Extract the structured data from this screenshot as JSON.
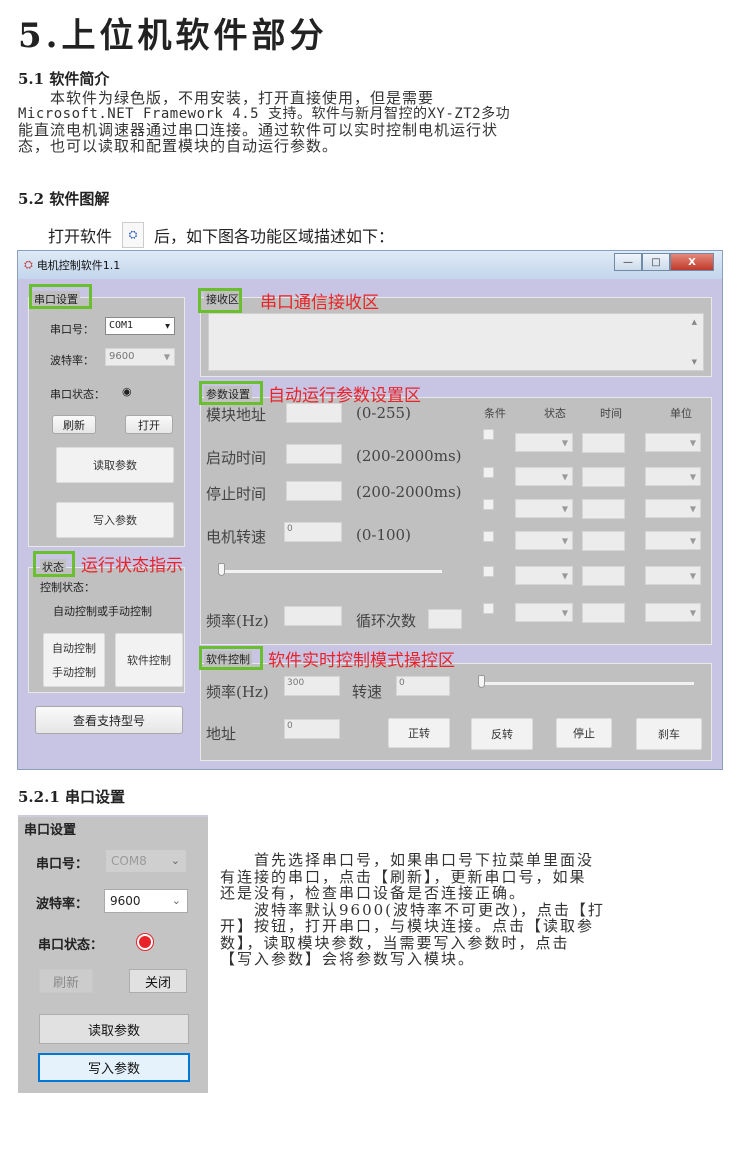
{
  "heading": "5.上位机软件部分",
  "section_5_1": {
    "title": "5.1 软件简介",
    "lines": [
      "　　本软件为绿色版，不用安装，打开直接使用，但是需要",
      "Microsoft.NET Framework 4.5 支持。软件与新月智控的XY-ZT2多功",
      "能直流电机调速器通过串口连接。通过软件可以实时控制电机运行状",
      "态，也可以读取和配置模块的自动运行参数。"
    ]
  },
  "section_5_2": {
    "title": "5.2 软件图解",
    "open_prefix": "打开软件",
    "open_suffix": "后，如下图各功能区域描述如下："
  },
  "window": {
    "title": "电机控制软件1.1",
    "buttons": {
      "minimize": "—",
      "maximize": "□",
      "close": "X"
    },
    "serial_group": {
      "label": "串口设置",
      "port_label": "串口号：",
      "port_value": "COM1",
      "baud_label": "波特率：",
      "baud_value": "9600",
      "status_label": "串口状态：",
      "status_indicator": "◉",
      "refresh": "刷新",
      "open": "打开",
      "read_params": "读取参数",
      "write_params": "写入参数"
    },
    "status_group": {
      "label": "状态",
      "annotation": "运行状态指示",
      "control_state_label": "控制状态：",
      "control_state_value": "自动控制或手动控制",
      "auto_control": "自动控制",
      "manual_control": "手动控制",
      "software_control": "软件控制"
    },
    "view_models": "查看支持型号",
    "receive_group": {
      "label": "接收区",
      "annotation": "串口通信接收区"
    },
    "param_group": {
      "label": "参数设置",
      "annotation": "自动运行参数设置区",
      "module_addr": "模块地址",
      "module_addr_range": "(0-255)",
      "start_time": "启动时间",
      "start_time_range": "(200-2000ms)",
      "stop_time": "停止时间",
      "stop_time_range": "(200-2000ms)",
      "motor_speed": "电机转速",
      "motor_speed_value": "0",
      "motor_speed_range": "(0-100)",
      "slider_value": 0,
      "frequency": "频率(Hz)",
      "loop_count": "循环次数",
      "col_condition": "条件",
      "col_state": "状态",
      "col_time": "时间",
      "col_unit": "单位",
      "rows": 6
    },
    "software_group": {
      "label": "软件控制",
      "annotation": "软件实时控制模式操控区",
      "frequency": "频率(Hz)",
      "frequency_value": "300",
      "speed": "转速",
      "speed_value": "0",
      "slider_value": 0,
      "address": "地址",
      "address_value": "0",
      "forward": "正转",
      "reverse": "反转",
      "stop": "停止",
      "brake": "刹车"
    }
  },
  "section_5_2_1": {
    "title": "5.2.1 串口设置",
    "panel": {
      "label": "串口设置",
      "port_label": "串口号：",
      "port_value": "COM8",
      "baud_label": "波特率：",
      "baud_value": "9600",
      "status_label": "串口状态：",
      "refresh": "刷新",
      "close": "关闭",
      "read_params": "读取参数",
      "write_params": "写入参数"
    },
    "lines": [
      "　　首先选择串口号，如果串口号下拉菜单里面没",
      "有连接的串口，点击【刷新】，更新串口号，如果",
      "还是没有，检查串口设备是否连接正确。",
      "　　波特率默认9600(波特率不可更改)，点击【打",
      "开】按钮，打开串口，与模块连接。点击【读取参",
      "数】，读取模块参数，当需要写入参数时，点击",
      "【写入参数】会将参数写入模块。"
    ]
  },
  "colors": {
    "annotation_red": "#e8242a",
    "highlight_green": "#6abf2e",
    "window_bg": "#c8c4e4",
    "group_bg": "#c0c0c0"
  }
}
